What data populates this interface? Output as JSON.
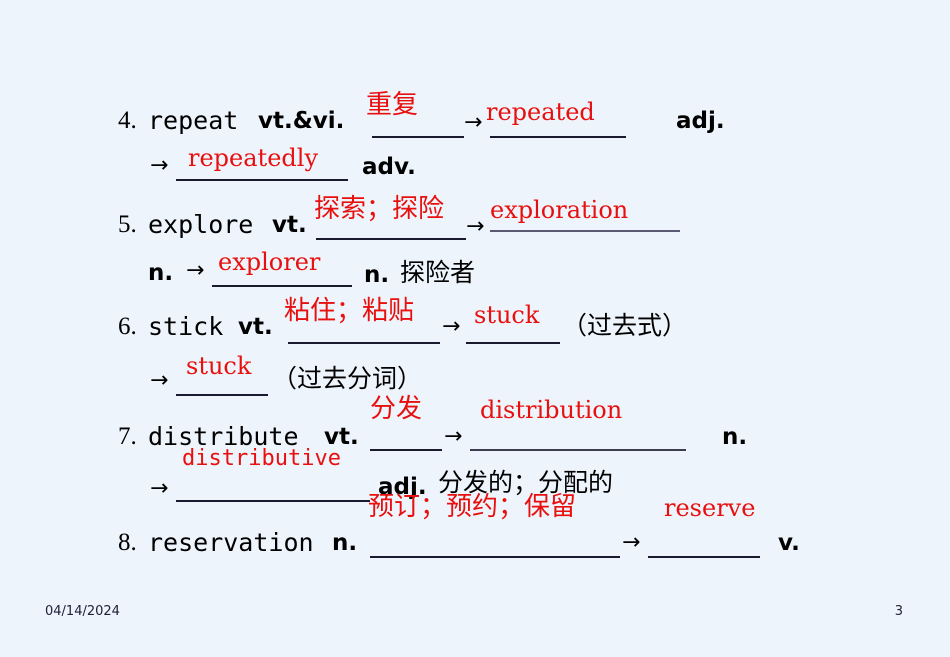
{
  "slide": {
    "background_color": "#eef4fb",
    "ink_black": "#000000",
    "ink_red": "#e8100f",
    "arrow_glyph": "→"
  },
  "entries": [
    {
      "number": "4.",
      "word": "repeat",
      "pos1": "vt.&vi.",
      "gloss_red": "重复",
      "arrow1": "→",
      "answer1": "repeated",
      "pos2": "adj.",
      "arrow2": "→",
      "answer2": "repeatedly",
      "pos3": "adv."
    },
    {
      "number": "5.",
      "word": "explore",
      "pos1": "vt.",
      "gloss_red": "探索；探险",
      "arrow1": "→",
      "answer1": "exploration",
      "pos2": "n.",
      "arrow2": "→",
      "answer2": "explorer",
      "pos3": "n.",
      "gloss_black": "探险者"
    },
    {
      "number": "6.",
      "word": "stick",
      "pos1": "vt.",
      "gloss_red": "粘住；粘贴",
      "arrow1": "→",
      "answer1": "stuck",
      "note1": "（过去式）",
      "arrow2": "→",
      "answer2": "stuck",
      "note2": "（过去分词）"
    },
    {
      "number": "7.",
      "word": "distribute",
      "pos1": "vt.",
      "gloss_red": "分发",
      "arrow1": "→",
      "answer1": "distribution",
      "pos2": "n.",
      "arrow2": "→",
      "answer2": "distributive",
      "pos3": "adj.",
      "gloss_black": "分发的；分配的"
    },
    {
      "number": "8.",
      "word": "reservation",
      "pos1": "n.",
      "gloss_red": "预订；预约；保留",
      "arrow1": "→",
      "answer1": "reserve",
      "pos2": "v."
    }
  ],
  "footer": {
    "date": "04/14/2024",
    "page_number": "3"
  }
}
